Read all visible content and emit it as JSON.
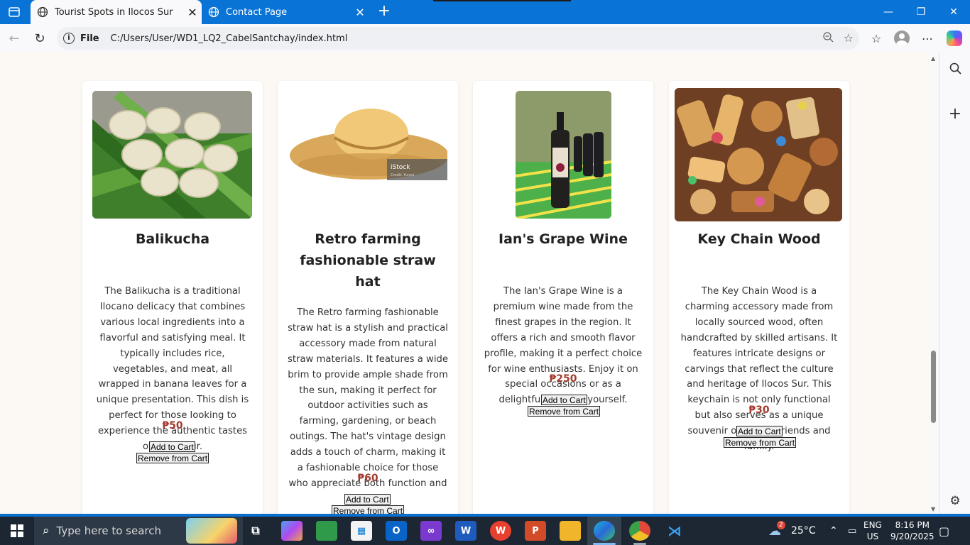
{
  "browser": {
    "tabs": [
      {
        "title": "Tourist Spots in Ilocos Sur",
        "active": true
      },
      {
        "title": "Contact Page",
        "active": false
      }
    ],
    "address": {
      "scheme_label": "File",
      "url": "C:/Users/User/WD1_LQ2_CabelSantchay/index.html"
    },
    "icons": [
      "tab-actions-icon",
      "globe-icon",
      "close-icon",
      "new-tab-icon",
      "minimize-icon",
      "maximize-icon",
      "back-icon",
      "refresh-icon",
      "info-icon",
      "zoom-icon",
      "favorite-star-icon",
      "favorites-icon",
      "profile-icon",
      "more-icon",
      "copilot-icon",
      "sidebar-search-icon",
      "sidebar-add-icon",
      "settings-icon"
    ]
  },
  "products": [
    {
      "name": "Balikucha",
      "description": "The Balikucha is a traditional Ilocano delicacy that combines various local ingredients into a flavorful and satisfying meal. It typically includes rice, vegetables, and meat, all wrapped in banana leaves for a unique presentation. This dish is perfect for those looking to experience the authentic tastes of Ilocos Sur.",
      "price": "₱50",
      "add_label": "Add to Cart",
      "remove_label": "Remove from Cart"
    },
    {
      "name": "Retro farming fashionable straw hat",
      "description": "The Retro farming fashionable straw hat is a stylish and practical accessory made from natural straw materials. It features a wide brim to provide ample shade from the sun, making it perfect for outdoor activities such as farming, gardening, or beach outings. The hat's vintage design adds a touch of charm, making it a fashionable choice for those who appreciate both function and style.",
      "price": "₱60",
      "add_label": "Add to Cart",
      "remove_label": "Remove from Cart",
      "image_watermark": "iStock",
      "image_credit": "Credit: Yurosi"
    },
    {
      "name": "Ian's Grape Wine",
      "description": "The Ian's Grape Wine is a premium wine made from the finest grapes in the region. It offers a rich and smooth flavor profile, making it a perfect choice for wine enthusiasts. Enjoy it on special occasions or as a delightful treat for yourself.",
      "price": "₱250",
      "add_label": "Add to Cart",
      "remove_label": "Remove from Cart"
    },
    {
      "name": "Key Chain Wood",
      "description": "The Key Chain Wood is a charming accessory made from locally sourced wood, often handcrafted by skilled artisans. It features intricate designs or carvings that reflect the culture and heritage of Ilocos Sur. This keychain is not only functional but also serves as a unique souvenir or gift for friends and family.",
      "price": "₱30",
      "add_label": "Add to Cart",
      "remove_label": "Remove from Cart"
    }
  ],
  "taskbar": {
    "search_placeholder": "Type here to search",
    "weather": {
      "badge": "2",
      "temperature": "25°C"
    },
    "language": {
      "line1": "ENG",
      "line2": "US"
    },
    "clock": {
      "time": "8:16 PM",
      "date": "9/20/2025"
    },
    "app_icons": [
      "copilot-app-icon",
      "image-app-icon",
      "store-icon",
      "outlook-icon",
      "visual-studio-icon",
      "word-icon",
      "wps-icon",
      "powerpoint-icon",
      "file-explorer-icon",
      "edge-icon",
      "chrome-icon",
      "vscode-icon"
    ]
  },
  "colors": {
    "titlebar": "#0a73d6",
    "page_background": "#fcf8f4",
    "price": "#a33a2c",
    "taskbar": "#1c2733"
  }
}
